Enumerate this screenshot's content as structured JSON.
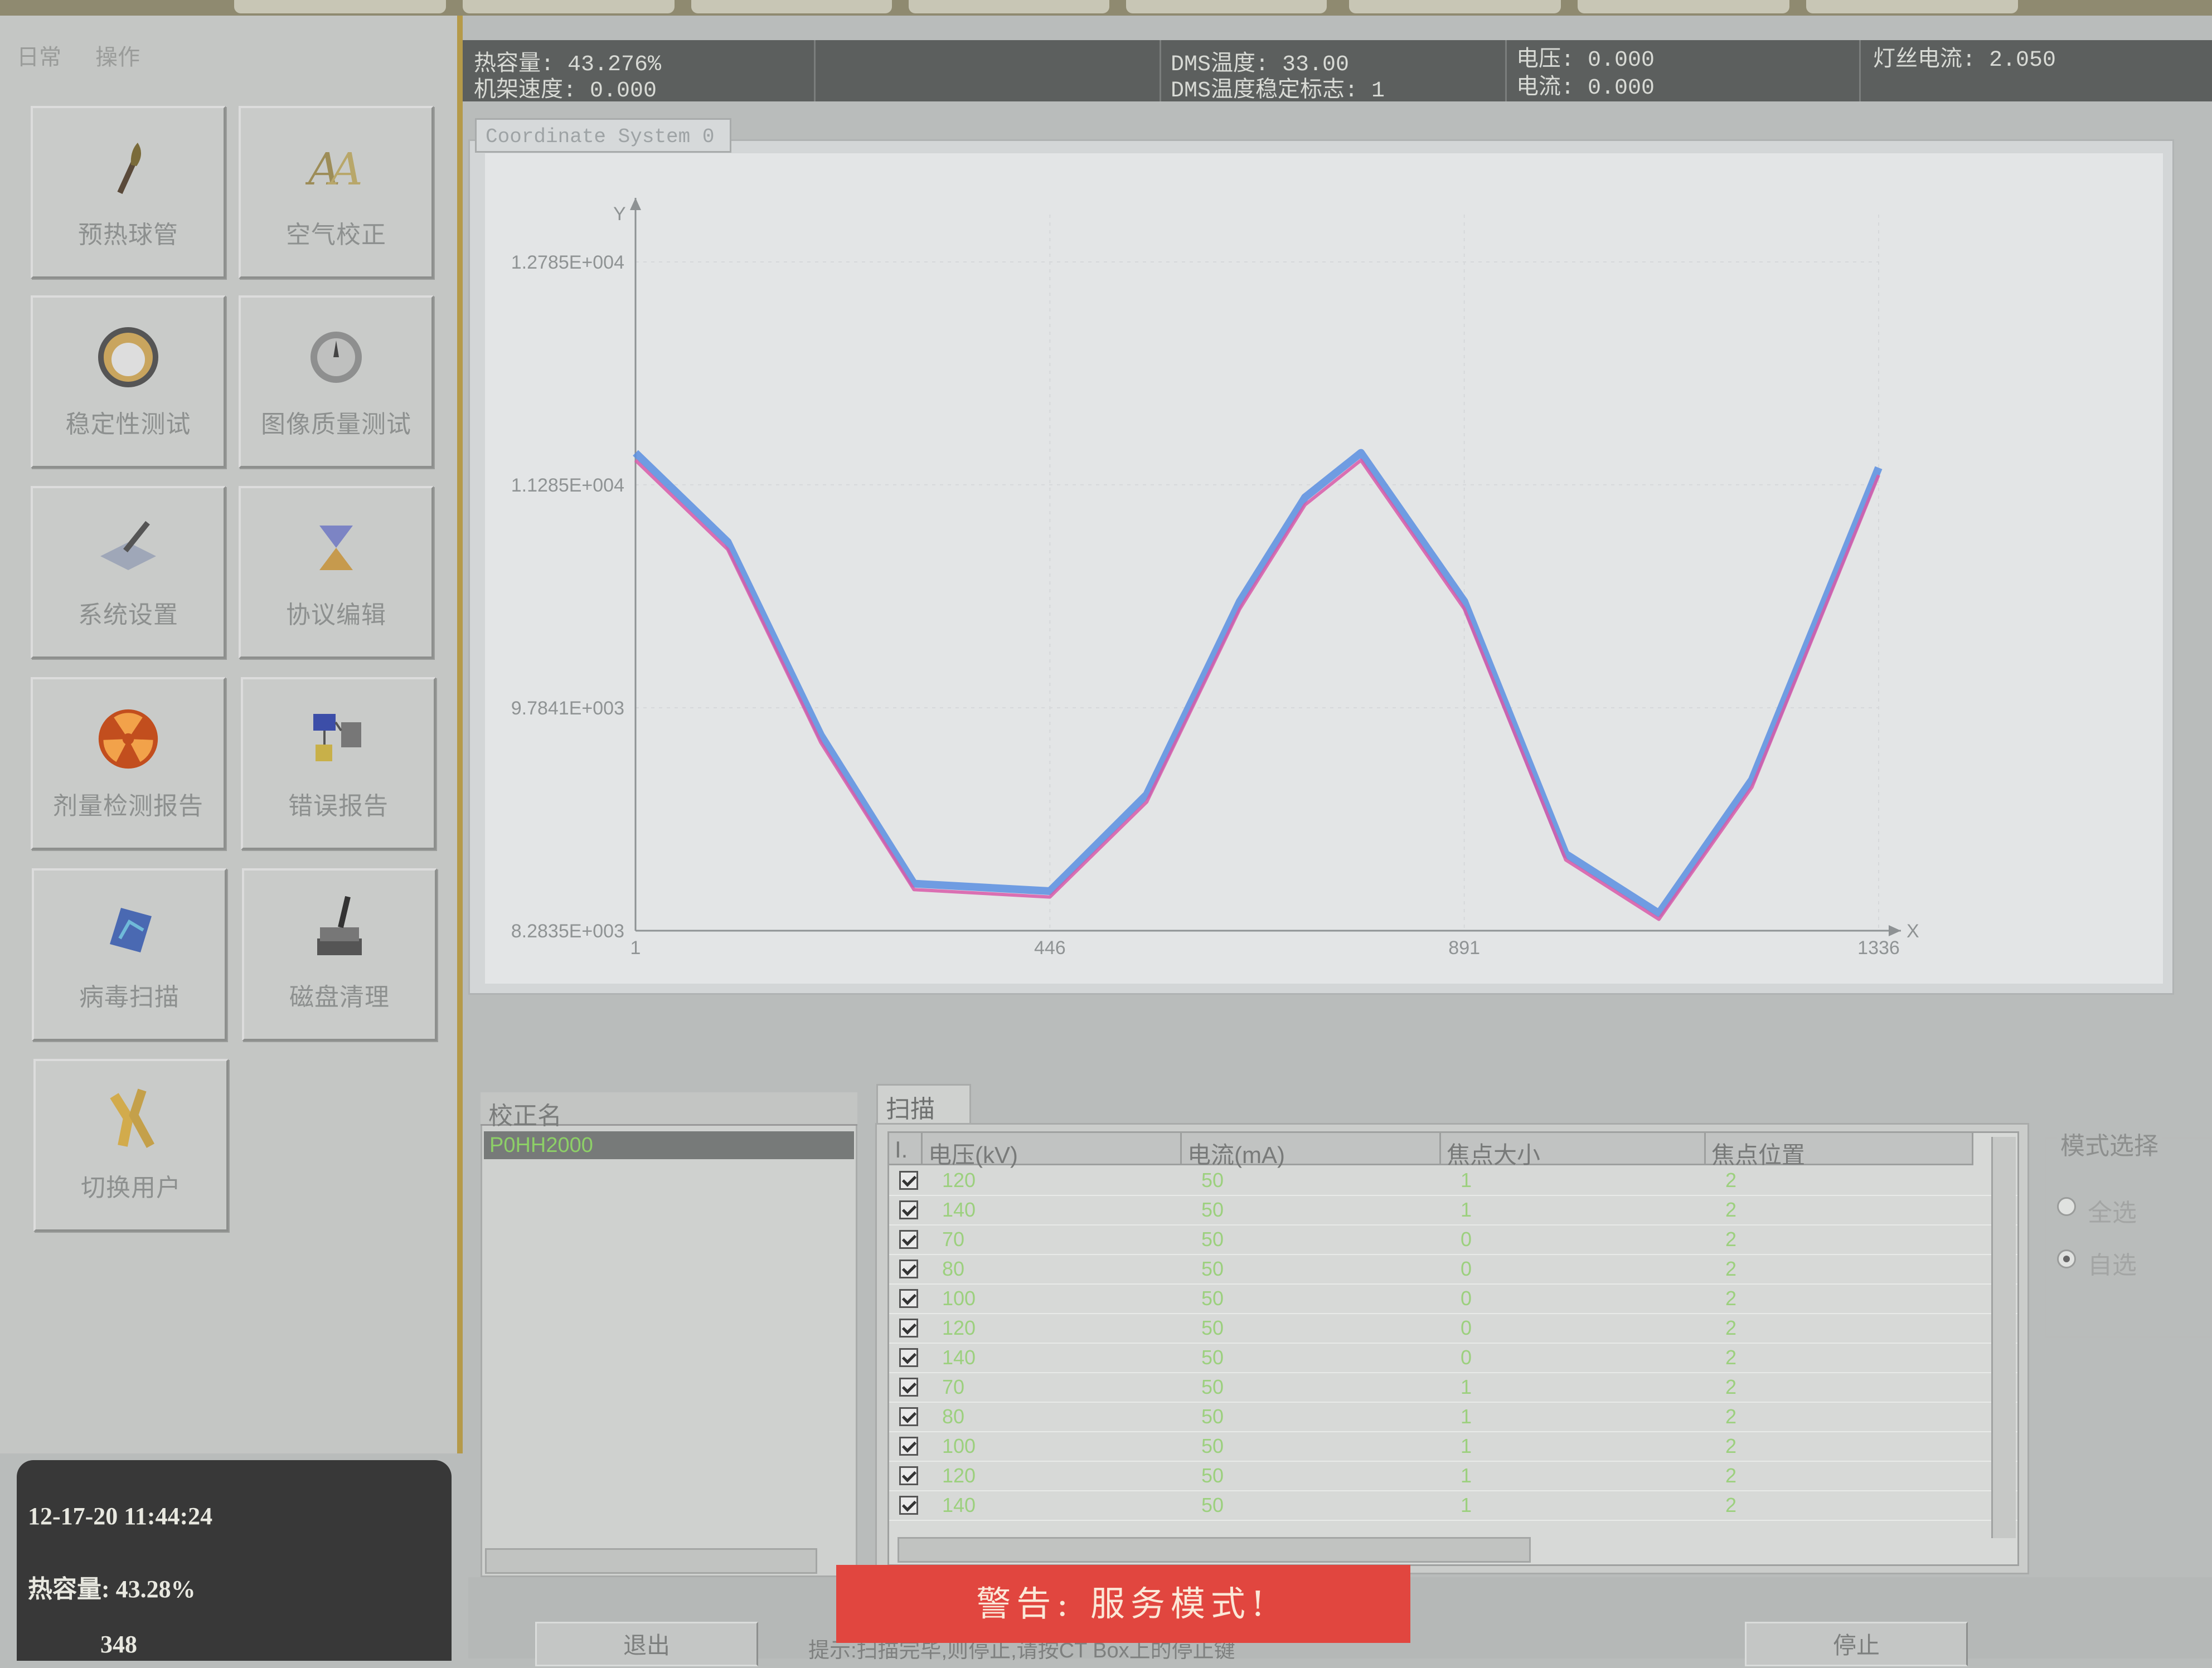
{
  "left_tabs": [
    "日常",
    "操作"
  ],
  "tools": [
    {
      "label": "预热球管",
      "icon": "torch-icon"
    },
    {
      "label": "空气校正",
      "icon": "air-calibration-icon"
    },
    {
      "label": "稳定性测试",
      "icon": "stability-test-icon"
    },
    {
      "label": "图像质量测试",
      "icon": "image-quality-icon"
    },
    {
      "label": "系统设置",
      "icon": "system-settings-icon"
    },
    {
      "label": "协议编辑",
      "icon": "protocol-edit-icon"
    },
    {
      "label": "剂量检测报告",
      "icon": "radiation-icon"
    },
    {
      "label": "错误报告",
      "icon": "error-report-icon"
    },
    {
      "label": "病毒扫描",
      "icon": "virus-scan-icon"
    },
    {
      "label": "磁盘清理",
      "icon": "disk-cleanup-icon"
    },
    {
      "label": "切换用户",
      "icon": "switch-user-icon"
    }
  ],
  "status": {
    "datetime": "12-17-20 11:44:24",
    "heat_capacity": "热容量: 43.28%",
    "count": "348"
  },
  "info_bar": {
    "heat_capacity": "热容量: 43.276%",
    "gantry_speed": "机架速度: 0.000",
    "dms_temp": "DMS温度: 33.00",
    "dms_temp_stable": "DMS温度稳定标志: 1",
    "voltage": "电压: 0.000",
    "current": "电流: 0.000",
    "filament_current": "灯丝电流: 2.050"
  },
  "chart_tab": "Coordinate System 0",
  "chart_data": {
    "type": "line",
    "xlabel": "X",
    "ylabel": "Y",
    "x_ticks": [
      "1",
      "446",
      "891",
      "1336"
    ],
    "y_ticks": [
      "1.2785E+004",
      "1.1285E+004",
      "9.7841E+003",
      "8.2835E+003"
    ],
    "xlim": [
      1,
      1336
    ],
    "ylim": [
      8283.5,
      12785
    ],
    "series": [
      {
        "color": "#5b8fe0",
        "x": [
          1,
          100,
          200,
          300,
          446,
          550,
          650,
          720,
          780,
          891,
          1000,
          1100,
          1200,
          1336
        ],
        "y": [
          11500,
          10900,
          9600,
          8600,
          8550,
          9200,
          10500,
          11200,
          11500,
          10500,
          8800,
          8400,
          9300,
          11400
        ]
      },
      {
        "color": "#d85aa8",
        "x": [
          1,
          100,
          200,
          300,
          446,
          550,
          650,
          720,
          780,
          891,
          1000,
          1100,
          1200,
          1336
        ],
        "y": [
          11450,
          10850,
          9550,
          8560,
          8510,
          9150,
          10450,
          11150,
          11450,
          10450,
          8760,
          8360,
          9250,
          11350
        ]
      }
    ]
  },
  "list": {
    "header": "校正名",
    "selected": "P0HH2000"
  },
  "scan": {
    "tab": "扫描",
    "columns": [
      "I.",
      "电压(kV)",
      "电流(mA)",
      "焦点大小",
      "焦点位置"
    ],
    "rows": [
      [
        "120",
        "50",
        "1",
        "2"
      ],
      [
        "140",
        "50",
        "1",
        "2"
      ],
      [
        "70",
        "50",
        "0",
        "2"
      ],
      [
        "80",
        "50",
        "0",
        "2"
      ],
      [
        "100",
        "50",
        "0",
        "2"
      ],
      [
        "120",
        "50",
        "0",
        "2"
      ],
      [
        "140",
        "50",
        "0",
        "2"
      ],
      [
        "70",
        "50",
        "1",
        "2"
      ],
      [
        "80",
        "50",
        "1",
        "2"
      ],
      [
        "100",
        "50",
        "1",
        "2"
      ],
      [
        "120",
        "50",
        "1",
        "2"
      ],
      [
        "140",
        "50",
        "1",
        "2"
      ]
    ]
  },
  "mode_select": {
    "title": "模式选择",
    "options": [
      "全选",
      "自选"
    ],
    "selected": "自选"
  },
  "warning": "警告: 服务模式!",
  "bottom": {
    "exit": "退出",
    "hint": "提示:扫描完毕,则停止,请按CT Box上的停止键",
    "stop": "停止"
  }
}
